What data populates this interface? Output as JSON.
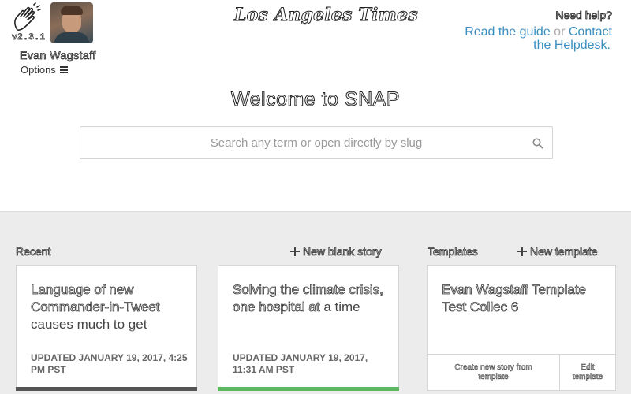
{
  "header": {
    "version": "v2.3.1",
    "user_name": "Evan Wagstaff",
    "options_label": "Options",
    "masthead": "Los Angeles Times",
    "help": {
      "title": "Need help?",
      "guide_link": "Read the guide",
      "or": "or",
      "contact_link_1": "Contact",
      "contact_link_2": "the Helpdesk."
    }
  },
  "main": {
    "welcome": "Welcome to SNAP",
    "search_placeholder": "Search any term or open directly by slug"
  },
  "recent": {
    "label": "Recent",
    "new_blank_story": "New blank story",
    "cards": [
      {
        "title_1": "Language of new Commander-in-Tweet",
        "title_2": "causes much to get",
        "updated": "UPDATED JANUARY 19, 2017, 4:25 PM PST",
        "bar_color": "#555555"
      },
      {
        "title_1": "Solving the climate crisis, one hospital at",
        "title_2": "a time",
        "updated": "UPDATED JANUARY 19, 2017, 11:31 AM PST",
        "bar_color": "#5cb85c"
      }
    ]
  },
  "templates": {
    "label": "Templates",
    "new_template": "New template",
    "card": {
      "title": "Evan Wagstaff Template Test Collec 6",
      "create_story": "Create new story from template",
      "edit_template": "Edit template"
    }
  },
  "colors": {
    "link": "#3a8fc0",
    "bottom_bg": "#ececec"
  }
}
